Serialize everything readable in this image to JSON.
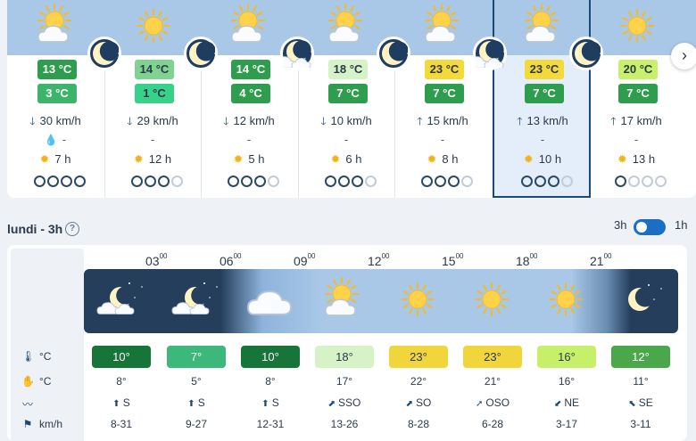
{
  "days": [
    {
      "icon": "sun-cloud-icon",
      "moon": true,
      "max": "13 °C",
      "max_color": "#2e9e4e",
      "max_dark": false,
      "min": "3 °C",
      "min_color": "#3cb56a",
      "wind": "30 km/h",
      "rain": "-",
      "rain_icon": true,
      "sun": "7 h",
      "rating": [
        1,
        1,
        1,
        1
      ]
    },
    {
      "icon": "sun-icon",
      "moon": true,
      "max": "14 °C",
      "max_color": "#7fd28f",
      "max_dark": true,
      "min": "1 °C",
      "min_color": "#37d18a",
      "wind": "29 km/h",
      "rain": "-",
      "rain_icon": false,
      "sun": "12 h",
      "rating": [
        1,
        1,
        1,
        0
      ]
    },
    {
      "icon": "sun-cloud-icon",
      "moon": true,
      "max": "14 °C",
      "max_color": "#2e9e4e",
      "max_dark": false,
      "min": "4 °C",
      "min_color": "#2e9e4e",
      "wind": "12 km/h",
      "rain": "-",
      "rain_icon": false,
      "sun": "5 h",
      "rating": [
        1,
        1,
        1,
        0
      ]
    },
    {
      "icon": "sun-cloud-icon",
      "moon": true,
      "max": "18 °C",
      "max_color": "#d6f3c8",
      "max_dark": true,
      "min": "7 °C",
      "min_color": "#2e9e4e",
      "wind": "10 km/h",
      "rain": "-",
      "rain_icon": false,
      "sun": "6 h",
      "rating": [
        1,
        1,
        1,
        0
      ]
    },
    {
      "icon": "sun-cloud-icon",
      "moon": true,
      "max": "23 °C",
      "max_color": "#f3d93a",
      "max_dark": true,
      "min": "7 °C",
      "min_color": "#2e9e4e",
      "wind": "15 km/h",
      "rain": "-",
      "rain_icon": false,
      "sun": "8 h",
      "rating": [
        1,
        1,
        1,
        0
      ]
    },
    {
      "icon": "sun-cloud-icon",
      "moon": true,
      "max": "23 °C",
      "max_color": "#f3d93a",
      "max_dark": true,
      "min": "7 °C",
      "min_color": "#2e9e4e",
      "wind": "13 km/h",
      "rain": "-",
      "rain_icon": false,
      "sun": "10 h",
      "rating": [
        1,
        1,
        1,
        0
      ],
      "selected": true
    },
    {
      "icon": "sun-icon",
      "moon": false,
      "max": "20 °C",
      "max_color": "#c8f06a",
      "max_dark": true,
      "min": "7 °C",
      "min_color": "#2e9e4e",
      "wind": "17 km/h",
      "rain": "-",
      "rain_icon": false,
      "sun": "13 h",
      "rating": [
        1,
        0,
        0,
        0
      ]
    }
  ],
  "section": {
    "title": "lundi - 3h",
    "help": "?"
  },
  "toggle": {
    "left": "3h",
    "right": "1h"
  },
  "hours": [
    {
      "label": "03",
      "sup": "00"
    },
    {
      "label": "06",
      "sup": "00"
    },
    {
      "label": "09",
      "sup": "00"
    },
    {
      "label": "12",
      "sup": "00"
    },
    {
      "label": "15",
      "sup": "00"
    },
    {
      "label": "18",
      "sup": "00"
    },
    {
      "label": "21",
      "sup": "00"
    }
  ],
  "band_icons": [
    "moon-cloud-icon",
    "moon-cloud-icon",
    "cloud-icon",
    "sun-cloud-icon",
    "sun-icon",
    "sun-icon",
    "sun-icon",
    "moon-icon"
  ],
  "row_labels": {
    "temp": "°C",
    "feels": "°C",
    "wind_dir": "",
    "wind_speed": "km/h"
  },
  "temps": [
    {
      "v": "10°",
      "c": "#17753a",
      "dark": false
    },
    {
      "v": "7°",
      "c": "#3cb97a",
      "dark": false
    },
    {
      "v": "10°",
      "c": "#17753a",
      "dark": false
    },
    {
      "v": "18°",
      "c": "#d6f3c8",
      "dark": true
    },
    {
      "v": "23°",
      "c": "#f0d63a",
      "dark": true
    },
    {
      "v": "23°",
      "c": "#f0d63a",
      "dark": true
    },
    {
      "v": "16°",
      "c": "#c6f06a",
      "dark": true
    },
    {
      "v": "12°",
      "c": "#4aa84a",
      "dark": false
    }
  ],
  "feels": [
    "8°",
    "5°",
    "8°",
    "17°",
    "22°",
    "21°",
    "16°",
    "11°"
  ],
  "wind_dirs": [
    "S",
    "S",
    "S",
    "SSO",
    "SO",
    "OSO",
    "NE",
    "SE"
  ],
  "wind_speeds": [
    "8-31",
    "9-27",
    "12-31",
    "13-26",
    "8-28",
    "6-28",
    "3-17",
    "3-11"
  ]
}
